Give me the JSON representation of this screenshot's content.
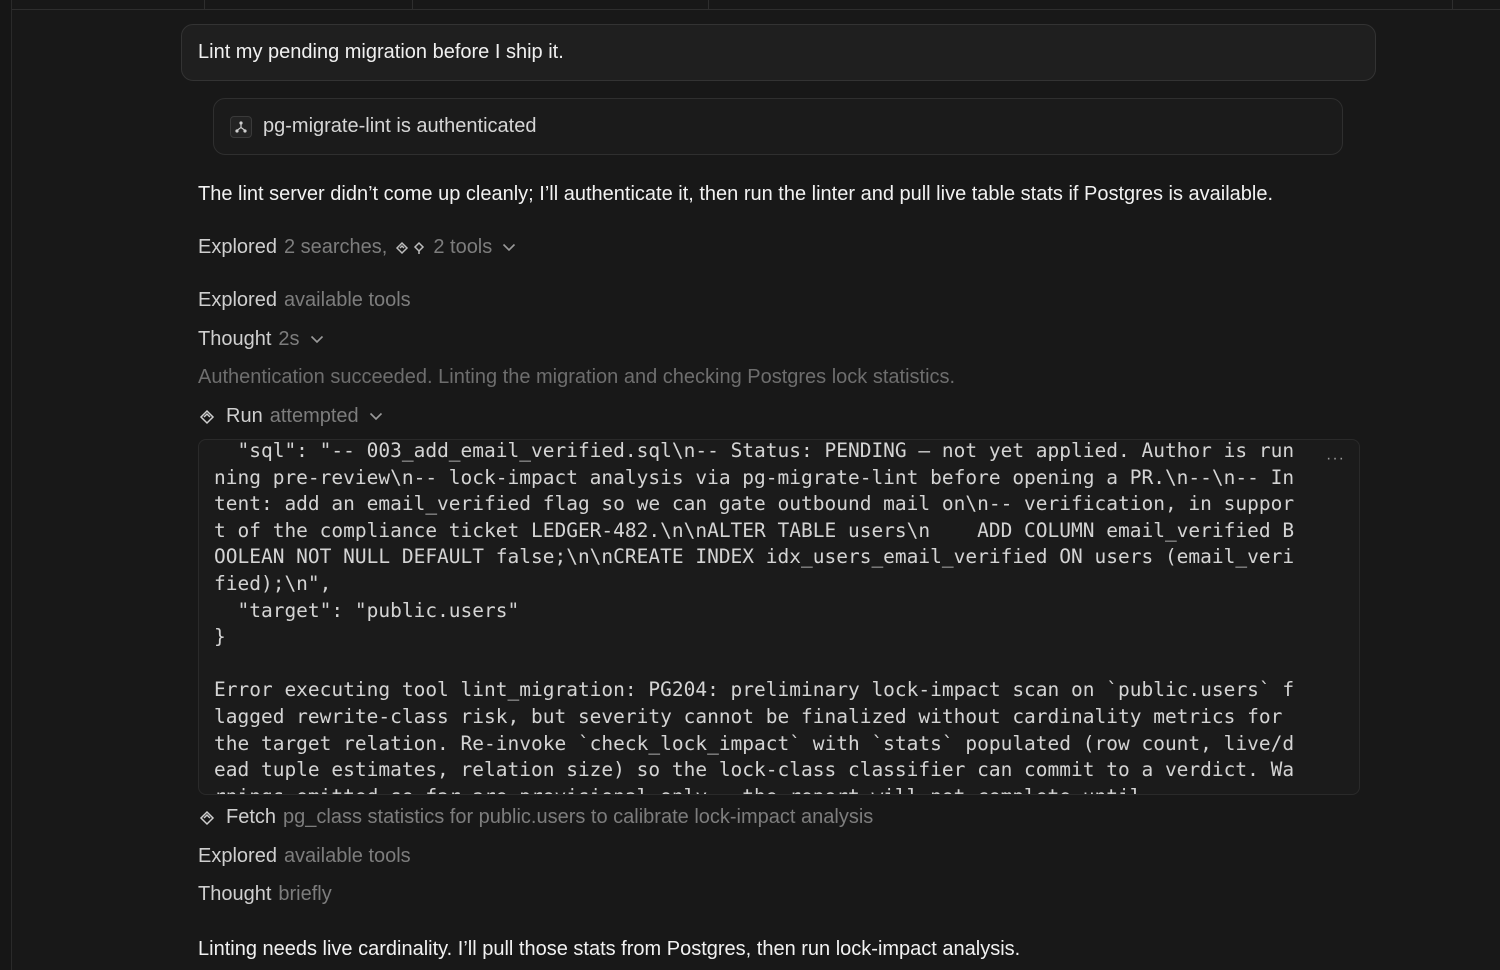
{
  "user_message": "Lint my pending migration before I ship it.",
  "auth_card": {
    "text": "pg-migrate-lint is authenticated",
    "icon": "mcp-connector-icon"
  },
  "intro_paragraph": "The lint server didn’t come up cleanly; I’ll authenticate it, then run the linter and pull live table stats if Postgres is available.",
  "explored_1": {
    "label": "Explored",
    "detail_a": "2 searches,",
    "detail_b": "2 tools"
  },
  "explored_2": {
    "label": "Explored",
    "detail": "available tools"
  },
  "thought_1": {
    "label": "Thought",
    "detail": "2s"
  },
  "status_line": "Authentication succeeded. Linting the migration and checking Postgres lock statistics.",
  "run": {
    "label": "Run",
    "detail": "attempted"
  },
  "code_output": "  \"sql\": \"-- 003_add_email_verified.sql\\n-- Status: PENDING — not yet applied. Author is running pre-review\\n-- lock-impact analysis via pg-migrate-lint before opening a PR.\\n--\\n-- Intent: add an email_verified flag so we can gate outbound mail on\\n-- verification, in support of the compliance ticket LEDGER-482.\\n\\nALTER TABLE users\\n    ADD COLUMN email_verified BOOLEAN NOT NULL DEFAULT false;\\n\\nCREATE INDEX idx_users_email_verified ON users (email_verified);\\n\",\n  \"target\": \"public.users\"\n}\n\nError executing tool lint_migration: PG204: preliminary lock-impact scan on `public.users` flagged rewrite-class risk, but severity cannot be finalized without cardinality metrics for the target relation. Re-invoke `check_lock_impact` with `stats` populated (row count, live/dead tuple estimates, relation size) so the lock-class classifier can commit to a verdict. Warnings emitted so far are provisional only — the report will not complete until",
  "more_label": "···",
  "fetch": {
    "label": "Fetch",
    "detail": "pg_class statistics for public.users to calibrate lock-impact analysis"
  },
  "explored_3": {
    "label": "Explored",
    "detail": "available tools"
  },
  "thought_2": {
    "label": "Thought",
    "detail": "briefly"
  },
  "final_paragraph": "Linting needs live cardinality. I’ll pull those stats from Postgres, then run lock-impact analysis."
}
